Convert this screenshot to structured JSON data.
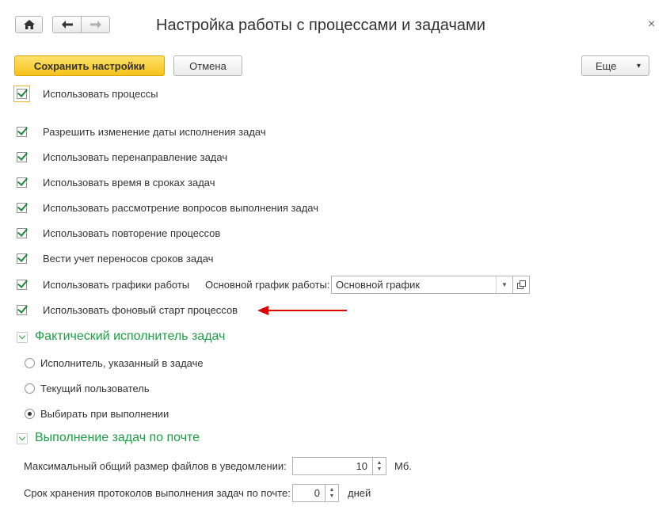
{
  "toolbar": {
    "home_icon": "home-icon",
    "back_icon": "arrow-left-icon",
    "forward_icon": "arrow-right-icon",
    "title": "Настройка работы с процессами и задачами",
    "close": "×"
  },
  "actions": {
    "save": "Сохранить настройки",
    "cancel": "Отмена",
    "more": "Еще",
    "more_arrow": "▾"
  },
  "options": {
    "use_processes": "Использовать процессы",
    "allow_date_change": "Разрешить изменение даты исполнения задач",
    "use_redirection": "Использовать перенаправление задач",
    "use_time": "Использовать время в сроках задач",
    "use_questions": "Использовать рассмотрение вопросов выполнения задач",
    "use_repeat": "Использовать повторение процессов",
    "track_transfers": "Вести учет переносов сроков задач",
    "use_schedules": "Использовать графики работы",
    "schedule_label": "Основной график работы:",
    "schedule_value": "Основной график",
    "use_background": "Использовать фоновый старт процессов"
  },
  "executor_section": {
    "title": "Фактический исполнитель задач",
    "options": [
      {
        "label": "Исполнитель, указанный в задаче",
        "selected": false
      },
      {
        "label": "Текущий пользователь",
        "selected": false
      },
      {
        "label": "Выбирать при выполнении",
        "selected": true
      }
    ]
  },
  "mail_section": {
    "title": "Выполнение задач по почте",
    "max_size_label": "Максимальный общий размер файлов в уведомлении:",
    "max_size_value": "10",
    "max_size_unit": "Мб.",
    "retention_label": "Срок хранения протоколов выполнения задач по почте:",
    "retention_value": "0",
    "retention_unit": "дней"
  },
  "colors": {
    "accent_green": "#1f9d46",
    "primary_button": "#f6c21a",
    "annotation_arrow": "#e00000"
  }
}
